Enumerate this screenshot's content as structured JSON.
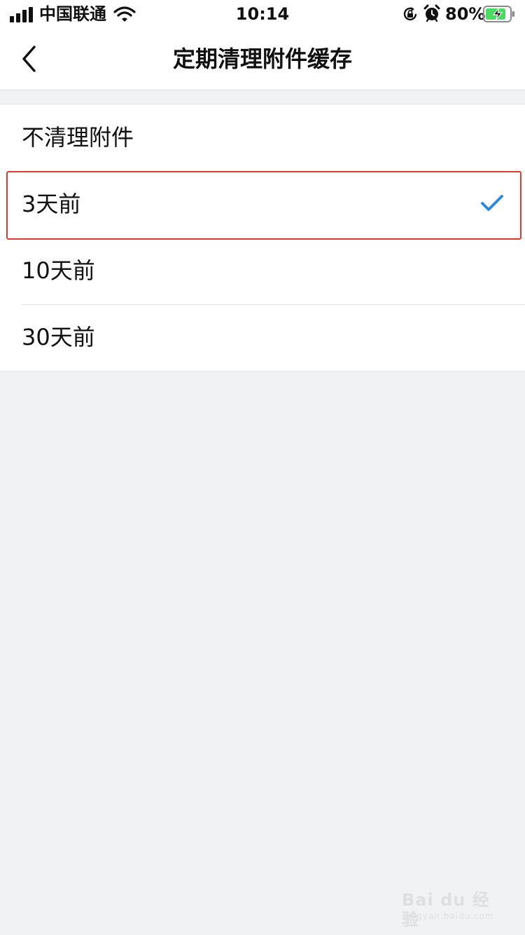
{
  "status_bar": {
    "carrier": "中国联通",
    "time": "10:14",
    "battery_percent": "80%",
    "icons": [
      "signal-icon",
      "wifi-icon",
      "orientation-lock-icon",
      "alarm-icon",
      "battery-charging-icon"
    ]
  },
  "nav": {
    "title": "定期清理附件缓存",
    "back_icon": "chevron-left-icon"
  },
  "options": [
    {
      "label": "不清理附件",
      "selected": false
    },
    {
      "label": "3天前",
      "selected": true
    },
    {
      "label": "10天前",
      "selected": false
    },
    {
      "label": "30天前",
      "selected": false
    }
  ],
  "colors": {
    "accent": "#2b88e0",
    "highlight_border": "#e03a31",
    "background": "#f1f2f4"
  },
  "watermark": {
    "brand": "Bai du 经验",
    "url": "jingyan.baidu.com"
  }
}
